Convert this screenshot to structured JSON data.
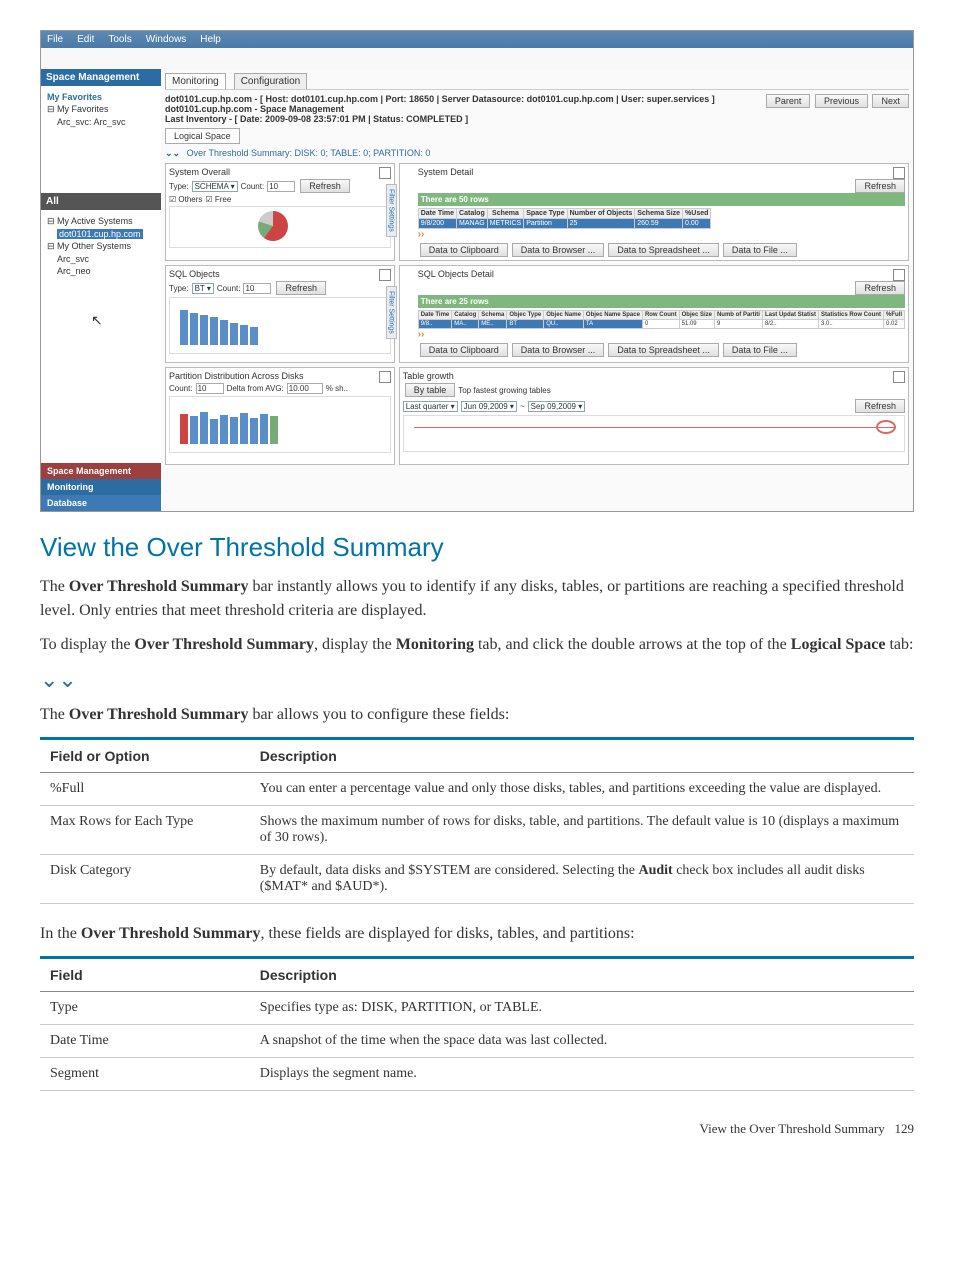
{
  "screenshot": {
    "menu": [
      "File",
      "Edit",
      "Tools",
      "Windows",
      "Help"
    ],
    "sidebar_header": "Space Management",
    "favorites": {
      "title": "My Favorites",
      "items": [
        "My Favorites",
        "Arc_svc: Arc_svc"
      ]
    },
    "all_header": "All",
    "active": {
      "title": "My Active Systems",
      "node": "dot0101.cup.hp.com"
    },
    "other": {
      "title": "My Other Systems",
      "items": [
        "Arc_svc",
        "Arc_neo"
      ]
    },
    "bottom_nav": [
      "Space Management",
      "Monitoring",
      "Database"
    ],
    "main_tabs": [
      "Monitoring",
      "Configuration"
    ],
    "breadcrumb": "dot0101.cup.hp.com - [ Host: dot0101.cup.hp.com | Port: 18650 | Server Datasource: dot0101.cup.hp.com | User: super.services ]",
    "subtitle": "dot0101.cup.hp.com - Space Management",
    "lastinv": "Last Inventory - [ Date: 2009-09-08 23:57:01 PM | Status: COMPLETED ]",
    "nav_buttons": [
      "Parent",
      "Previous",
      "Next"
    ],
    "logical_tab": "Logical Space",
    "ots": "Over Threshold Summary: DISK: 0; TABLE: 0; PARTITION: 0",
    "panel_sysov": {
      "title": "System Overall",
      "type_label": "Type:",
      "type_value": "SCHEMA",
      "count_label": "Count:",
      "count_value": "10",
      "refresh": "Refresh",
      "others": "Others",
      "free": "Free"
    },
    "panel_sysdet": {
      "title": "System Detail",
      "rows": "There are 50 rows",
      "headers": [
        "Date Time",
        "Catalog",
        "Schema",
        "Space Type",
        "Number of Objects",
        "Schema Size",
        "%Used"
      ],
      "datarow": [
        "9/8/200",
        "MANAG",
        "METRICS",
        "Partition",
        "25",
        "260.59",
        "0.00"
      ],
      "buttons": [
        "Data to Clipboard",
        "Data to Browser ...",
        "Data to Spreadsheet ...",
        "Data to File ..."
      ],
      "refresh": "Refresh"
    },
    "panel_sqlov": {
      "title": "SQL Objects",
      "type_label": "Type:",
      "type_value": "BT",
      "count_label": "Count:",
      "count_value": "10",
      "refresh": "Refresh"
    },
    "panel_sqldet": {
      "title": "SQL Objects Detail",
      "rows": "There are 25 rows",
      "headers": [
        "Date Time",
        "Catalog",
        "Schema",
        "Objec Type",
        "Objec Name",
        "Objec Name Space",
        "Row Count",
        "Objec Size",
        "Numb of Partiti",
        "Last Updat Statist",
        "Statistics Row Count",
        "%Full"
      ],
      "datarow": [
        "9/8..",
        "MA..",
        "ME..",
        "BT",
        "QU..",
        "TA",
        "0",
        "51.09",
        "9",
        "8/2..",
        "3.0..",
        "0.02"
      ],
      "buttons": [
        "Data to Clipboard",
        "Data to Browser ...",
        "Data to Spreadsheet ...",
        "Data to File ..."
      ],
      "refresh": "Refresh"
    },
    "panel_part": {
      "title": "Partition Distribution Across Disks",
      "count_label": "Count:",
      "count_value": "10",
      "delta_label": "Delta from AVG:",
      "delta_value": "10.00",
      "unit": "% sh.."
    },
    "panel_growth": {
      "title": "Table growth",
      "bytable": "By table",
      "toptables": "Top fastest growing tables",
      "last_quarter": "Last quarter",
      "date1": "Jun 09,2009",
      "date2": "Sep 09,2009",
      "refresh": "Refresh"
    },
    "filter_label": "Filter Settings"
  },
  "heading": "View the Over Threshold Summary",
  "para1a": "The ",
  "para1b": "Over Threshold Summary",
  "para1c": " bar instantly allows you to identify if any disks, tables, or partitions are reaching a specified threshold level. Only entries that meet threshold criteria are displayed.",
  "para2a": "To display the ",
  "para2b": "Over Threshold Summary",
  "para2c": ", display the ",
  "para2d": "Monitoring",
  "para2e": " tab, and click the double arrows at the top of the ",
  "para2f": "Logical Space",
  "para2g": " tab:",
  "para3a": "The ",
  "para3b": "Over Threshold Summary",
  "para3c": " bar allows you to configure these fields:",
  "table1": {
    "h1": "Field or Option",
    "h2": "Description",
    "rows": [
      {
        "f": "%Full",
        "d": "You can enter a percentage value and only those disks, tables, and partitions exceeding the value are displayed."
      },
      {
        "f": "Max Rows for Each Type",
        "d": "Shows the maximum number of rows for disks, table, and partitions. The default value is 10 (displays a maximum of 30 rows)."
      },
      {
        "f": "Disk Category",
        "d_pre": "By default, data disks and $SYSTEM are considered. Selecting the ",
        "d_b": "Audit",
        "d_post": " check box includes all audit disks ($MAT* and $AUD*)."
      }
    ]
  },
  "para4a": "In the ",
  "para4b": "Over Threshold Summary",
  "para4c": ", these fields are displayed for disks, tables, and partitions:",
  "table2": {
    "h1": "Field",
    "h2": "Description",
    "rows": [
      {
        "f": "Type",
        "d": "Specifies type as: DISK, PARTITION, or TABLE."
      },
      {
        "f": "Date Time",
        "d": "A snapshot of the time when the space data was last collected."
      },
      {
        "f": "Segment",
        "d": "Displays the segment name."
      }
    ]
  },
  "footer_text": "View the Over Threshold Summary",
  "footer_page": "129"
}
